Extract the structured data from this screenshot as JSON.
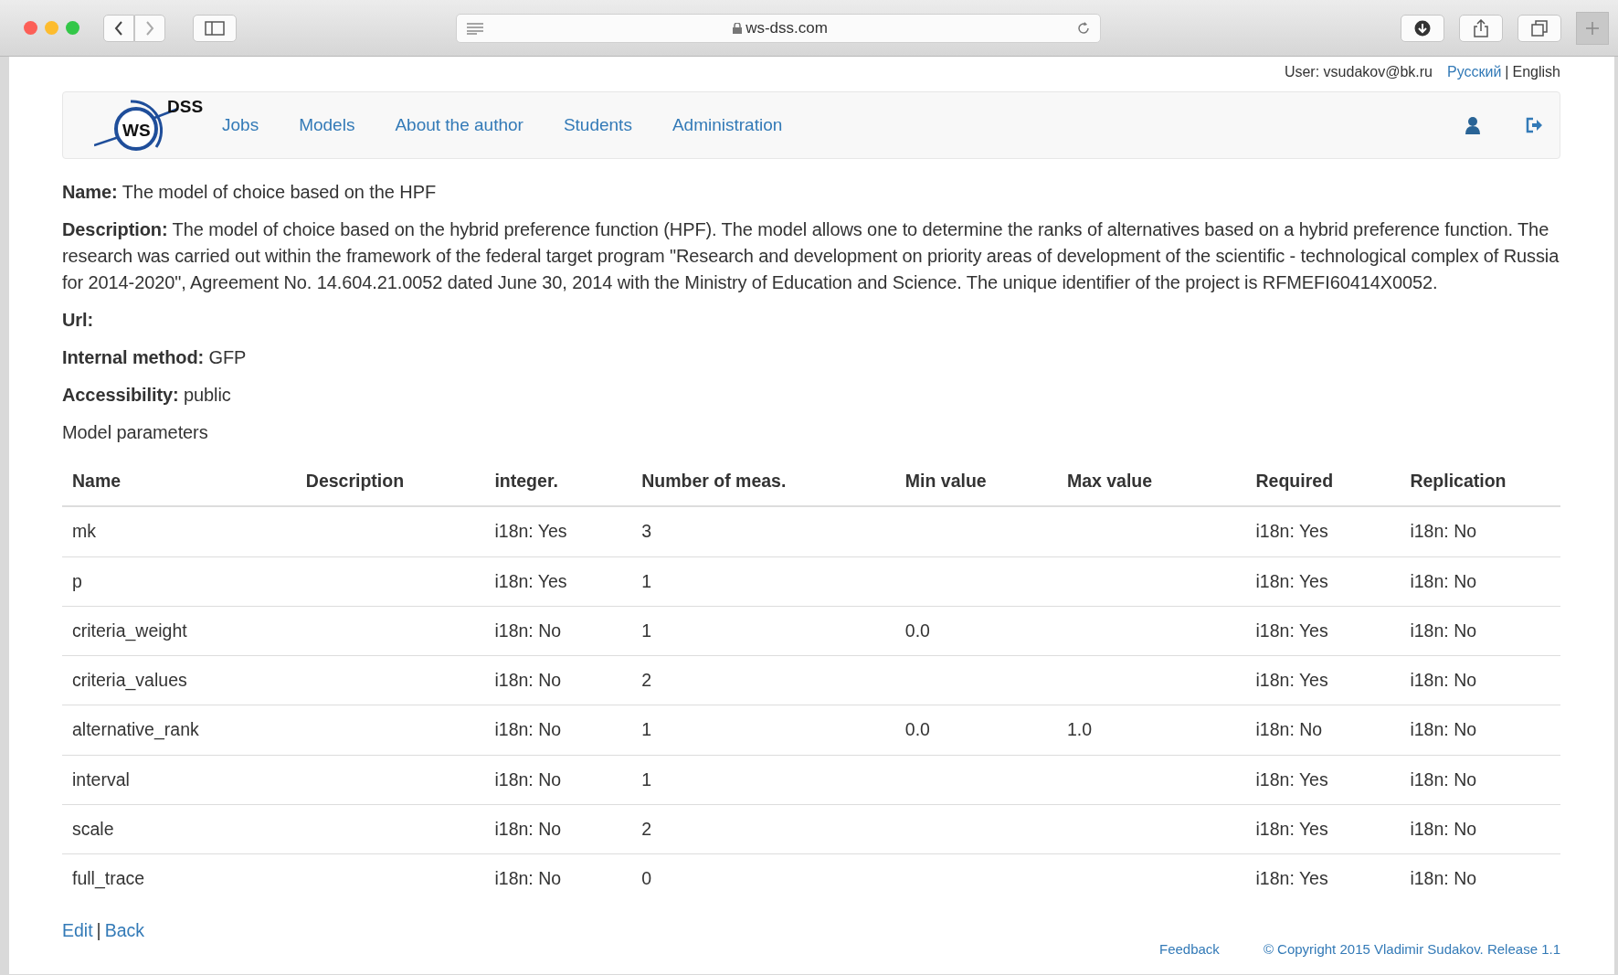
{
  "browser": {
    "url": "ws-dss.com"
  },
  "user_bar": {
    "user": "User: vsudakov@bk.ru",
    "separator": "|",
    "languages": [
      {
        "label": "Русский",
        "selected": false
      },
      {
        "label": "English",
        "selected": true
      }
    ]
  },
  "navbar": {
    "logo": {
      "main": "WS",
      "sup": "DSS"
    },
    "items": [
      "Jobs",
      "Models",
      "About the author",
      "Students",
      "Administration"
    ]
  },
  "fields": [
    {
      "label": "Name:",
      "value": "The model of choice based on the HPF"
    },
    {
      "label": "Description:",
      "value": "The model of choice based on the hybrid preference function (HPF). The model allows one to determine the ranks of alternatives based on a hybrid preference function. The research was carried out within the framework of the federal target program \"Research and development on priority areas of development of the scientific - technological complex of Russia for 2014-2020\", Agreement No. 14.604.21.0052 dated June 30, 2014 with the Ministry of Education and Science. The unique identifier of the project is RFMEFI60414X0052."
    },
    {
      "label": "Url:"
    },
    {
      "label": "Internal method:",
      "value": "GFP"
    },
    {
      "label": "Accessibility:",
      "value": "public"
    }
  ],
  "section_title": "Model parameters",
  "table": {
    "columns": [
      "Name",
      "Description",
      "integer.",
      "Number of meas.",
      "Min value",
      "Max value",
      "Required",
      "Replication"
    ],
    "rows": [
      [
        "mk",
        "",
        "i18n: Yes",
        "3",
        "",
        "",
        "i18n: Yes",
        "i18n: No"
      ],
      [
        "p",
        "",
        "i18n: Yes",
        "1",
        "",
        "",
        "i18n: Yes",
        "i18n: No"
      ],
      [
        "criteria_weight",
        "",
        "i18n: No",
        "1",
        "0.0",
        "",
        "i18n: Yes",
        "i18n: No"
      ],
      [
        "criteria_values",
        "",
        "i18n: No",
        "2",
        "",
        "",
        "i18n: Yes",
        "i18n: No"
      ],
      [
        "alternative_rank",
        "",
        "i18n: No",
        "1",
        "0.0",
        "1.0",
        "i18n: No",
        "i18n: No"
      ],
      [
        "interval",
        "",
        "i18n: No",
        "1",
        "",
        "",
        "i18n: Yes",
        "i18n: No"
      ],
      [
        "scale",
        "",
        "i18n: No",
        "2",
        "",
        "",
        "i18n: Yes",
        "i18n: No"
      ],
      [
        "full_trace",
        "",
        "i18n: No",
        "0",
        "",
        "",
        "i18n: Yes",
        "i18n: No"
      ]
    ]
  },
  "actions": {
    "links": [
      "Edit",
      "Back"
    ],
    "separator": "|"
  },
  "footer": [
    "Feedback",
    "© Copyright 2015 Vladimir Sudakov. Release 1.1"
  ]
}
